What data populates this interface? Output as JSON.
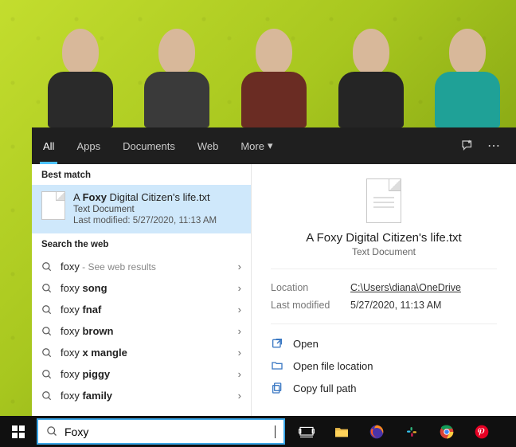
{
  "tabs": {
    "all": "All",
    "apps": "Apps",
    "documents": "Documents",
    "web": "Web",
    "more": "More"
  },
  "sections": {
    "best": "Best match",
    "web": "Search the web"
  },
  "best_match": {
    "title_pre": "A ",
    "title_bold": "Foxy",
    "title_post": " Digital Citizen's life.txt",
    "subtitle": "Text Document",
    "modified": "Last modified: 5/27/2020, 11:13 AM"
  },
  "web_results": [
    {
      "q": "foxy",
      "bold": "",
      "note": " - See web results"
    },
    {
      "q": "foxy ",
      "bold": "song",
      "note": ""
    },
    {
      "q": "foxy ",
      "bold": "fnaf",
      "note": ""
    },
    {
      "q": "foxy ",
      "bold": "brown",
      "note": ""
    },
    {
      "q": "foxy ",
      "bold": "x mangle",
      "note": ""
    },
    {
      "q": "foxy ",
      "bold": "piggy",
      "note": ""
    },
    {
      "q": "foxy ",
      "bold": "family",
      "note": ""
    }
  ],
  "preview": {
    "title": "A Foxy Digital Citizen's life.txt",
    "subtitle": "Text Document",
    "location_label": "Location",
    "location_value": "C:\\Users\\diana\\OneDrive",
    "modified_label": "Last modified",
    "modified_value": "5/27/2020, 11:13 AM"
  },
  "actions": {
    "open": "Open",
    "open_loc": "Open file location",
    "copy_path": "Copy full path"
  },
  "search": {
    "value": "Foxy"
  }
}
